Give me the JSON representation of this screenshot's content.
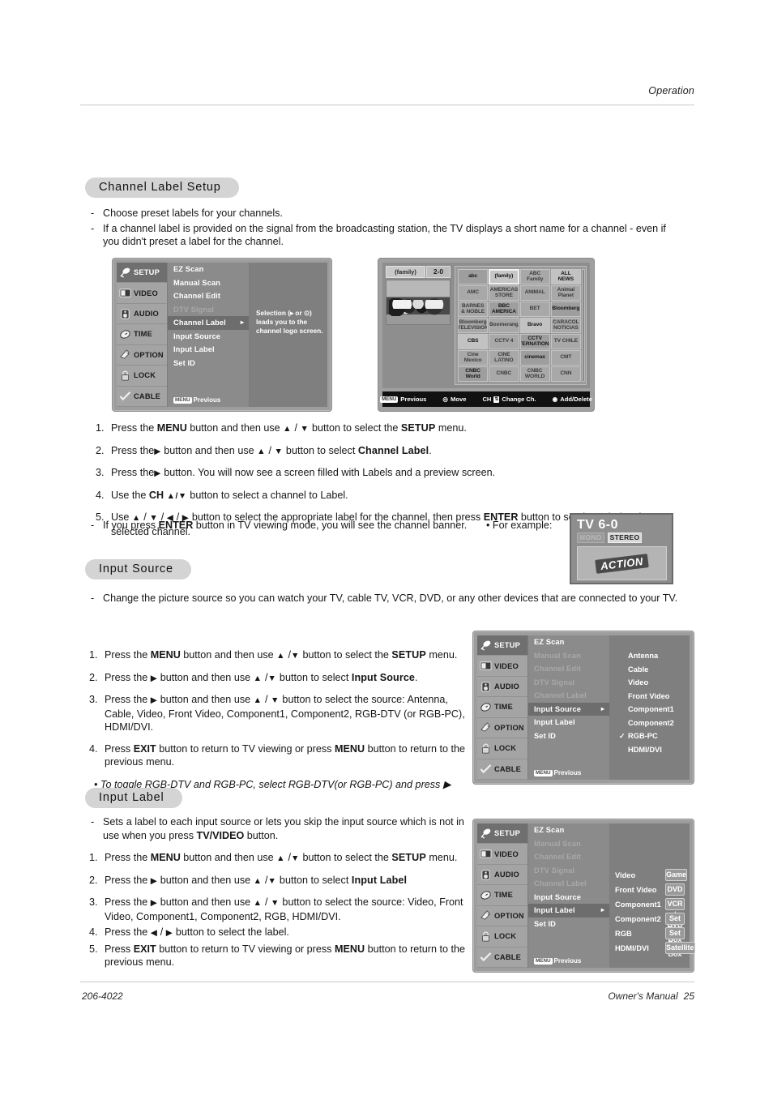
{
  "header": {
    "section": "Operation"
  },
  "footer": {
    "code": "206-4022",
    "manual": "Owner's Manual",
    "page": "25"
  },
  "sections": {
    "channel_label_setup": {
      "pill": "Channel Label Setup",
      "bullets": [
        "Choose preset labels for your channels.",
        "If a channel label is provided on the signal from the broadcasting station, the TV displays a short name for a channel - even if you didn't preset a label for the channel."
      ],
      "steps": [
        {
          "n": "1.",
          "text": "Press the MENU button and then use ▲ / ▼ button to select the SETUP menu."
        },
        {
          "n": "2.",
          "text": "Press the ▶ button and then use ▲ / ▼ button to select Channel Label."
        },
        {
          "n": "3.",
          "text": "Press the ▶ button. You will now see a screen filled with Labels and a preview screen."
        },
        {
          "n": "4.",
          "text": "Use the CH ▲/▼ button to select a channel to Label."
        },
        {
          "n": "5.",
          "text": "Use ▲ / ▼ / ◀ / ▶ button to select the appropriate label for the channel, then press ENTER button to set the Label to the selected channel."
        }
      ],
      "enter_note": "If you press ENTER button in TV viewing mode, you will see the channel banner.",
      "example_label": "• For example:"
    },
    "input_source": {
      "pill": "Input Source",
      "bullet": "Change the picture source so you can watch your TV, cable TV, VCR, DVD, or any other devices that are connected to your TV.",
      "steps": [
        {
          "n": "1.",
          "text": "Press the MENU button and then use ▲ /▼ button to select the SETUP menu."
        },
        {
          "n": "2.",
          "text": "Press the ▶ button and then use ▲ /▼ button to select Input Source."
        },
        {
          "n": "3.",
          "text": "Press the ▶ button and then use ▲ / ▼ button to select the source: Antenna, Cable, Video, Front Video, Component1, Component2, RGB-DTV (or RGB-PC), HDMI/DVI."
        },
        {
          "n": "4.",
          "text": "Press EXIT button to return to TV viewing or press MENU button to return to the previous menu."
        }
      ],
      "note": "• To toggle RGB-DTV and RGB-PC, select RGB-DTV(or RGB-PC) and press ▶ button."
    },
    "input_label": {
      "pill": "Input Label",
      "bullet": "Sets a label to each input source or lets you skip the input source which is not in use when you press TV/VIDEO button.",
      "steps": [
        {
          "n": "1.",
          "text": "Press the MENU button and then use ▲ /▼ button to select the SETUP menu."
        },
        {
          "n": "2.",
          "text": "Press the ▶ button and then use ▲ /▼ button to select Input Label"
        },
        {
          "n": "3.",
          "text": "Press the ▶ button and then use ▲ / ▼ button to select the source: Video, Front Video, Component1, Component2, RGB, HDMI/DVI."
        },
        {
          "n": "4.",
          "text": "Press the ◀ / ▶ button to select the label."
        },
        {
          "n": "5.",
          "text": "Press EXIT button to return to TV viewing or press MENU button to return to the previous menu."
        }
      ]
    }
  },
  "osd_categories": [
    {
      "label": "SETUP",
      "icon": "satellite-dish-icon",
      "selected": true
    },
    {
      "label": "VIDEO",
      "icon": "monitor-icon",
      "selected": false
    },
    {
      "label": "AUDIO",
      "icon": "speaker-icon",
      "selected": false
    },
    {
      "label": "TIME",
      "icon": "clock-icon",
      "selected": false
    },
    {
      "label": "OPTION",
      "icon": "hand-pointer-icon",
      "selected": false
    },
    {
      "label": "LOCK",
      "icon": "padlock-icon",
      "selected": false
    },
    {
      "label": "CABLE",
      "icon": "check-plug-icon",
      "selected": false
    }
  ],
  "osd_menu_channel_label": {
    "items": [
      {
        "label": "EZ Scan",
        "state": "normal"
      },
      {
        "label": "Manual Scan",
        "state": "normal"
      },
      {
        "label": "Channel Edit",
        "state": "normal"
      },
      {
        "label": "DTV Signal",
        "state": "dim"
      },
      {
        "label": "Channel Label",
        "state": "selected"
      },
      {
        "label": "Input Source",
        "state": "normal"
      },
      {
        "label": "Input Label",
        "state": "normal"
      },
      {
        "label": "Set ID",
        "state": "normal"
      }
    ],
    "previous": "Previous",
    "menu_key": "MENU",
    "tip": "Selection (▸ or ⊙) leads you to the channel logo screen."
  },
  "osd_menu_input_source": {
    "items": [
      {
        "label": "EZ Scan",
        "state": "normal"
      },
      {
        "label": "Manual Scan",
        "state": "dim"
      },
      {
        "label": "Channel Edit",
        "state": "dim"
      },
      {
        "label": "DTV Signal",
        "state": "dim"
      },
      {
        "label": "Channel Label",
        "state": "dim"
      },
      {
        "label": "Input Source",
        "state": "selected"
      },
      {
        "label": "Input Label",
        "state": "normal"
      },
      {
        "label": "Set ID",
        "state": "normal"
      }
    ],
    "previous": "Previous",
    "menu_key": "MENU",
    "options": [
      {
        "label": "Antenna",
        "checked": false
      },
      {
        "label": "Cable",
        "checked": false
      },
      {
        "label": "Video",
        "checked": false
      },
      {
        "label": "Front Video",
        "checked": false
      },
      {
        "label": "Component1",
        "checked": false
      },
      {
        "label": "Component2",
        "checked": false
      },
      {
        "label": "RGB-PC",
        "checked": true
      },
      {
        "label": "HDMI/DVI",
        "checked": false
      }
    ]
  },
  "osd_menu_input_label": {
    "items": [
      {
        "label": "EZ Scan",
        "state": "normal"
      },
      {
        "label": "Manual Scan",
        "state": "dim"
      },
      {
        "label": "Channel Edit",
        "state": "dim"
      },
      {
        "label": "DTV Signal",
        "state": "dim"
      },
      {
        "label": "Channel Label",
        "state": "dim"
      },
      {
        "label": "Input Source",
        "state": "normal"
      },
      {
        "label": "Input Label",
        "state": "selected"
      },
      {
        "label": "Set ID",
        "state": "normal"
      }
    ],
    "previous": "Previous",
    "menu_key": "MENU",
    "labels": [
      {
        "source": "Video",
        "value": "Game"
      },
      {
        "source": "Front Video",
        "value": "DVD"
      },
      {
        "source": "Component1",
        "value": "VCR / DVD"
      },
      {
        "source": "Component2",
        "value": "Set Top Box"
      },
      {
        "source": "RGB",
        "value": "Set Top Box"
      },
      {
        "source": "HDMI/DVI",
        "value": "Satellite"
      }
    ]
  },
  "channel_logo_screen": {
    "preview": {
      "logo": "(family)",
      "channel": "2-0"
    },
    "logos": [
      {
        "text": "abc",
        "style": "dark"
      },
      {
        "text": "(family)",
        "style": "hl"
      },
      {
        "text": "ABC Family",
        "style": "normal"
      },
      {
        "text": "ALL NEWS",
        "style": "bright"
      },
      {
        "text": "AMC",
        "style": "normal"
      },
      {
        "text": "AMERICAS STORE",
        "style": "normal"
      },
      {
        "text": "ANIMAL",
        "style": "normal"
      },
      {
        "text": "Animal Planet",
        "style": "normal"
      },
      {
        "text": "BARNES & NOBLE",
        "style": "normal"
      },
      {
        "text": "BBC AMERICA",
        "style": "dark"
      },
      {
        "text": "BET",
        "style": "normal"
      },
      {
        "text": "Bloomberg",
        "style": "dark"
      },
      {
        "text": "Bloomberg TELEVISION",
        "style": "normal"
      },
      {
        "text": "Boomerang",
        "style": "normal"
      },
      {
        "text": "Bravo",
        "style": "bright"
      },
      {
        "text": "CARACOL NOTICIAS",
        "style": "normal"
      },
      {
        "text": "CBS",
        "style": "bright"
      },
      {
        "text": "CCTV 4",
        "style": "normal"
      },
      {
        "text": "CCTV INTERNATIONAL",
        "style": "dark"
      },
      {
        "text": "TV CHILE",
        "style": "normal"
      },
      {
        "text": "Cine Mexico",
        "style": "normal"
      },
      {
        "text": "CINE LATINO",
        "style": "normal"
      },
      {
        "text": "cinemax",
        "style": "dark"
      },
      {
        "text": "CMT",
        "style": "normal"
      },
      {
        "text": "CNBC World",
        "style": "dark"
      },
      {
        "text": "CNBC",
        "style": "normal"
      },
      {
        "text": "CNBC WORLD",
        "style": "normal"
      },
      {
        "text": "CNN",
        "style": "normal"
      }
    ],
    "bottom_bar": [
      {
        "key": "MENU",
        "label": "Previous",
        "icon": "menu-key-icon"
      },
      {
        "key": "",
        "label": "Move",
        "icon": "dpad-icon"
      },
      {
        "key": "CH",
        "label": "Change Ch.",
        "icon": "ch-updown-icon"
      },
      {
        "key": "",
        "label": "Add/Delete",
        "icon": "enter-circle-icon"
      }
    ]
  },
  "banner_example": {
    "title": "TV 6-0",
    "tags": [
      {
        "text": "MONO",
        "active": false
      },
      {
        "text": "STEREO",
        "active": true
      }
    ],
    "logo": "ACTION"
  }
}
